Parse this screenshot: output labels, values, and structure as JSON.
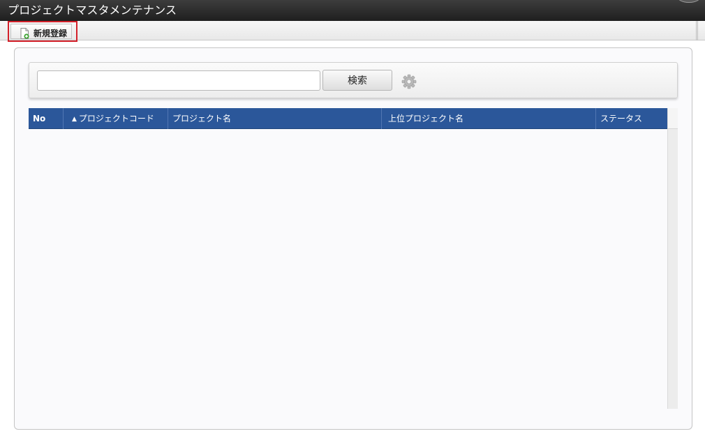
{
  "window": {
    "title": "プロジェクトマスタメンテナンス"
  },
  "toolbar": {
    "new_label": "新規登録"
  },
  "search": {
    "value": "",
    "placeholder": "",
    "button_label": "検索"
  },
  "table": {
    "columns": [
      {
        "label": "No"
      },
      {
        "label": "プロジェクトコード",
        "sort": "▲"
      },
      {
        "label": "プロジェクト名"
      },
      {
        "label": "上位プロジェクト名"
      },
      {
        "label": "ステータス"
      }
    ],
    "rows": []
  },
  "icons": {
    "new": "document-add-icon",
    "settings": "gear-icon"
  },
  "colors": {
    "header_bg": "#2b579a",
    "highlight": "#d3202a",
    "titlebar": "#2a2a2a"
  }
}
